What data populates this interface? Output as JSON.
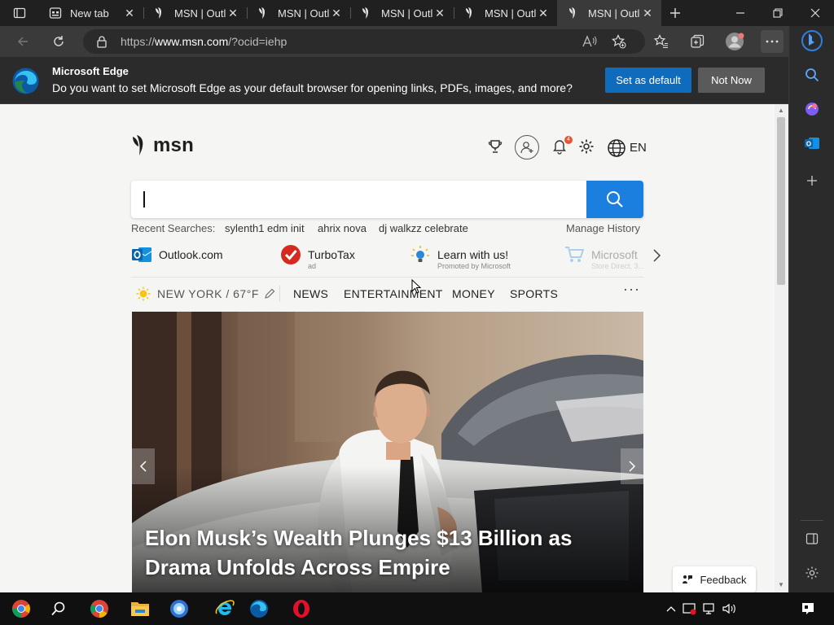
{
  "browser": {
    "tabs": [
      {
        "title": "New tab",
        "icon": "newtab-icon",
        "active": false
      },
      {
        "title": "MSN | Outlo",
        "icon": "msn-butterfly-icon",
        "active": false
      },
      {
        "title": "MSN | Outlo",
        "icon": "msn-butterfly-icon",
        "active": false
      },
      {
        "title": "MSN | Outlo",
        "icon": "msn-butterfly-icon",
        "active": false
      },
      {
        "title": "MSN | Outlo",
        "icon": "msn-butterfly-icon",
        "active": false
      },
      {
        "title": "MSN | Outlo",
        "icon": "msn-butterfly-icon",
        "active": true
      }
    ],
    "url_prefix": "https://",
    "url_host": "www.msn.com",
    "url_path": "/?ocid=iehp",
    "accent_color": "#0f6cbd"
  },
  "infobar": {
    "title": "Microsoft Edge",
    "message": "Do you want to set Microsoft Edge as your default browser for opening links, PDFs, images, and more?",
    "set_default_label": "Set as default",
    "not_now_label": "Not Now"
  },
  "msn": {
    "logo_text": "msn",
    "notification_count": "4",
    "language": "EN",
    "search": {
      "value": "",
      "placeholder": ""
    },
    "recent_label": "Recent Searches:",
    "recent_searches": [
      "sylenth1 edm init",
      "ahrix nova",
      "dj walkzz celebrate"
    ],
    "manage_history": "Manage History",
    "quick_links": [
      {
        "name": "Outlook.com",
        "sub": ""
      },
      {
        "name": "TurboTax",
        "sub": "ad"
      },
      {
        "name": "Learn with us!",
        "sub": "Promoted by Microsoft"
      },
      {
        "name": "Microsoft",
        "sub": "Store Direct, 3..."
      }
    ],
    "weather": "NEW YORK / 67°F",
    "nav": [
      "NEWS",
      "ENTERTAINMENT",
      "MONEY",
      "SPORTS"
    ],
    "nav_more": "···",
    "hero_headline": "Elon Musk’s Wealth Plunges $13 Billion as Drama Unfolds Across Empire",
    "feedback_label": "Feedback"
  }
}
